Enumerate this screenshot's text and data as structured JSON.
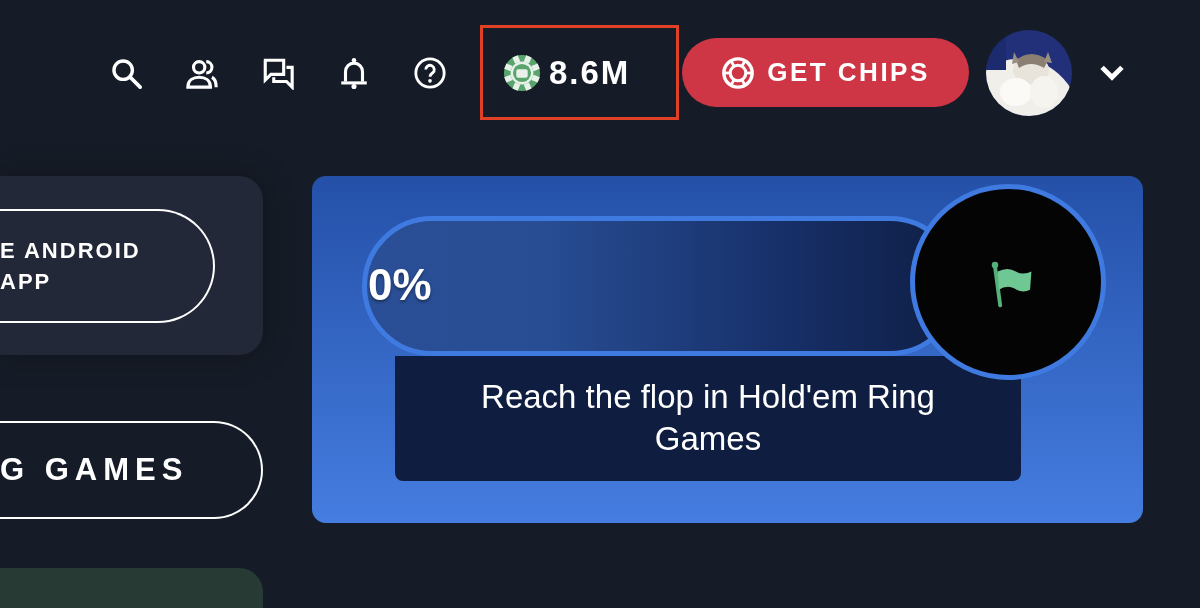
{
  "header": {
    "icons": [
      {
        "kind": "search"
      },
      {
        "kind": "friends"
      },
      {
        "kind": "chat"
      },
      {
        "kind": "bell"
      },
      {
        "kind": "help"
      }
    ],
    "balance": {
      "amount": "8.6M",
      "highlighted": true
    },
    "get_chips": {
      "label": "GET CHIPS"
    },
    "menu": {
      "expanded": false
    }
  },
  "sidebar": {
    "cards": [
      {
        "kind": "app",
        "label": "E ANDROID APP"
      },
      {
        "kind": "games",
        "label": "G GAMES"
      },
      {
        "kind": "green"
      }
    ]
  },
  "mission": {
    "progress": {
      "label": "0%",
      "level": 0
    },
    "description": "Reach the flop in Hold'em Ring Games"
  }
}
